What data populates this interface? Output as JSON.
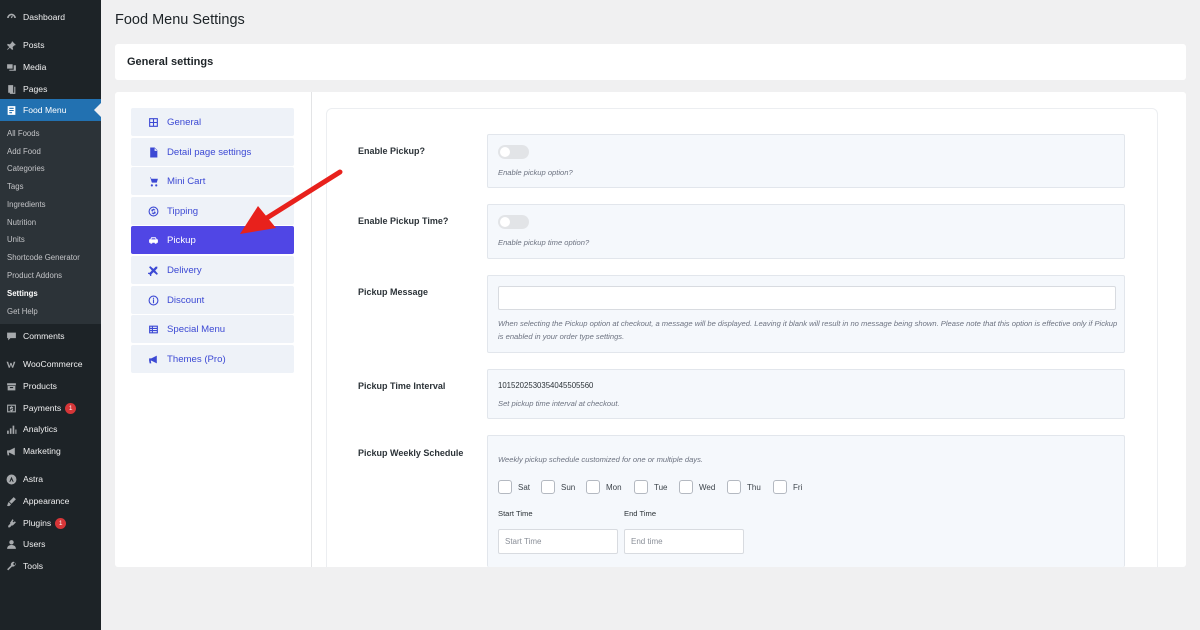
{
  "admin_menu": {
    "top_items": [
      {
        "label": "Dashboard",
        "icon": "dashboard-icon"
      },
      {
        "label": "Posts",
        "icon": "pin-icon"
      },
      {
        "label": "Media",
        "icon": "media-icon"
      },
      {
        "label": "Pages",
        "icon": "pages-icon"
      },
      {
        "label": "Food Menu",
        "icon": "food-menu-icon"
      }
    ],
    "submenu": [
      "All Foods",
      "Add Food",
      "Categories",
      "Tags",
      "Ingredients",
      "Nutrition",
      "Units",
      "Shortcode Generator",
      "Product Addons",
      "Settings",
      "Get Help"
    ],
    "bottom_items": [
      {
        "label": "Comments",
        "icon": "comment-icon"
      },
      {
        "label": "WooCommerce",
        "icon": "woocommerce-icon"
      },
      {
        "label": "Products",
        "icon": "products-icon"
      },
      {
        "label": "Payments",
        "icon": "payments-icon",
        "badge": "1"
      },
      {
        "label": "Analytics",
        "icon": "analytics-icon"
      },
      {
        "label": "Marketing",
        "icon": "megaphone-icon"
      },
      {
        "label": "Astra",
        "icon": "astra-icon"
      },
      {
        "label": "Appearance",
        "icon": "brush-icon"
      },
      {
        "label": "Plugins",
        "icon": "plugin-icon",
        "badge": "1"
      },
      {
        "label": "Users",
        "icon": "user-icon"
      },
      {
        "label": "Tools",
        "icon": "wrench-icon"
      }
    ]
  },
  "page": {
    "title": "Food Menu Settings",
    "section_title": "General settings"
  },
  "tabs": [
    {
      "label": "General",
      "icon": "grid-icon"
    },
    {
      "label": "Detail page settings",
      "icon": "document-icon"
    },
    {
      "label": "Mini Cart",
      "icon": "cart-icon"
    },
    {
      "label": "Tipping",
      "icon": "dollar-icon"
    },
    {
      "label": "Pickup",
      "icon": "car-icon"
    },
    {
      "label": "Delivery",
      "icon": "plane-icon"
    },
    {
      "label": "Discount",
      "icon": "info-icon"
    },
    {
      "label": "Special Menu",
      "icon": "list-icon"
    },
    {
      "label": "Themes (Pro)",
      "icon": "megaphone-icon"
    }
  ],
  "active_tab": "Pickup",
  "fields": {
    "enable_pickup": {
      "label": "Enable Pickup?",
      "desc": "Enable pickup option?"
    },
    "enable_pickup_time": {
      "label": "Enable Pickup Time?",
      "desc": "Enable pickup time option?"
    },
    "pickup_message": {
      "label": "Pickup Message",
      "value": "",
      "desc": "When selecting the Pickup option at checkout, a message will be displayed. Leaving it blank will result in no message being shown. Please note that this option is effective only if Pickup is enabled in your order type settings."
    },
    "pickup_time_interval": {
      "label": "Pickup Time Interval",
      "value": "1015202530354045505560",
      "desc": "Set pickup time interval at checkout."
    },
    "pickup_weekly_schedule": {
      "label": "Pickup Weekly Schedule",
      "desc": "Weekly pickup schedule customized for one or multiple days.",
      "days": [
        "Sat",
        "Sun",
        "Mon",
        "Tue",
        "Wed",
        "Thu",
        "Fri"
      ],
      "start_time_label": "Start Time",
      "end_time_label": "End Time",
      "start_time_placeholder": "Start Time",
      "end_time_placeholder": "End time"
    }
  },
  "colors": {
    "wp_sidebar": "#1d2327",
    "wp_active": "#2271b1",
    "tab_active": "#5046e5",
    "tab_text": "#3c49d4"
  }
}
